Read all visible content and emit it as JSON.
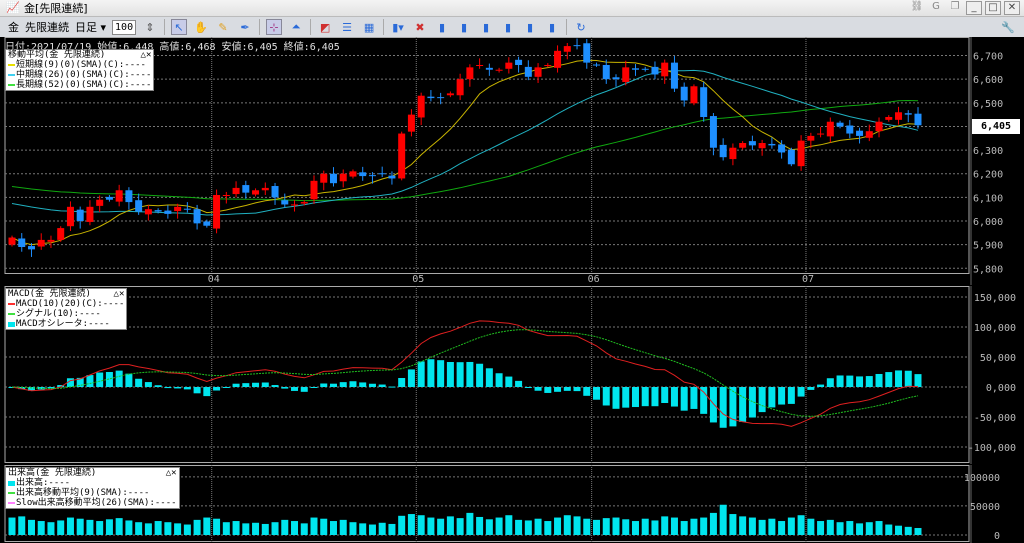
{
  "window": {
    "title": "金[先限連続]"
  },
  "toolbar": {
    "symbol": "金",
    "contract": "先限連続",
    "period": "日足",
    "bars": "100"
  },
  "info": {
    "text": "日付:2021/07/19 始値:6,448 高値:6,468 安値:6,405 終値:6,405"
  },
  "last_price": "6,405",
  "legends": {
    "ma": {
      "title": "移動平均(金 先限連続)",
      "items": [
        {
          "label": "短期線(9)(0)(SMA)(C):----",
          "color": "#e8e000"
        },
        {
          "label": "中期線(26)(0)(SMA)(C):----",
          "color": "#40d0f0"
        },
        {
          "label": "長期線(52)(0)(SMA)(C):----",
          "color": "#40e040"
        }
      ]
    },
    "macd": {
      "title": "MACD(金 先限連続)",
      "items": [
        {
          "label": "MACD(10)(20)(C):----",
          "color": "#ff3030"
        },
        {
          "label": "シグナル(10):----",
          "color": "#40e040"
        },
        {
          "label": "MACDオシレータ:----",
          "color": "#00e5ee"
        }
      ]
    },
    "volume": {
      "title": "出来高(金 先限連続)",
      "items": [
        {
          "label": "出来高:----",
          "color": "#00e5ee"
        },
        {
          "label": "出来高移動平均(9)(SMA):----",
          "color": "#40e040"
        },
        {
          "label": "Slow出来高移動平均(26)(SMA):----",
          "color": "#ff80ff"
        }
      ]
    }
  },
  "colors": {
    "up": "#ff0000",
    "down": "#1e8fff",
    "ma9": "#c8b400",
    "ma26": "#20b0c0",
    "ma52": "#10a810",
    "macd": "#e02020",
    "signal": "#20c020",
    "osc": "#00e5ee"
  },
  "months": [
    {
      "label": "04",
      "index": 20.5
    },
    {
      "label": "05",
      "index": 41.5
    },
    {
      "label": "06",
      "index": 59.5
    },
    {
      "label": "07",
      "index": 81.5
    }
  ],
  "price_axis": {
    "ticks": [
      "6,700",
      "6,600",
      "6,500",
      "6,400",
      "6,300",
      "6,200",
      "6,100",
      "6,000",
      "5,900",
      "5,800"
    ],
    "values": [
      6700,
      6600,
      6500,
      6400,
      6300,
      6200,
      6100,
      6000,
      5900,
      5800
    ]
  },
  "macd_axis": {
    "ticks": [
      "150,000",
      "100,000",
      "50,000",
      "0,000",
      "-50,000",
      "-100,000"
    ],
    "values": [
      150000,
      100000,
      50000,
      0,
      -50000,
      -100000
    ]
  },
  "volume_axis": {
    "ticks": [
      "100000",
      "50000",
      "0"
    ],
    "values": [
      100000,
      50000,
      0
    ]
  },
  "chart_data": {
    "type": "candlestick",
    "closes": [
      5930,
      5890,
      5880,
      5920,
      5920,
      5970,
      6060,
      6000,
      6060,
      6090,
      6090,
      6130,
      6080,
      6040,
      6050,
      6040,
      6030,
      6060,
      6050,
      5990,
      5980,
      6110,
      6110,
      6140,
      6120,
      6130,
      6140,
      6100,
      6070,
      6070,
      6080,
      6170,
      6200,
      6160,
      6200,
      6210,
      6190,
      6190,
      6200,
      6180,
      6370,
      6450,
      6530,
      6520,
      6520,
      6540,
      6600,
      6650,
      6660,
      6640,
      6640,
      6670,
      6660,
      6610,
      6650,
      6660,
      6720,
      6740,
      6740,
      6670,
      6660,
      6600,
      6600,
      6650,
      6640,
      6640,
      6620,
      6670,
      6560,
      6510,
      6570,
      6440,
      6310,
      6270,
      6310,
      6330,
      6320,
      6330,
      6320,
      6290,
      6240,
      6340,
      6360,
      6370,
      6420,
      6400,
      6370,
      6360,
      6380,
      6420,
      6440,
      6460,
      6450,
      6405
    ],
    "volumes": [
      30000,
      32000,
      26000,
      24000,
      22000,
      25000,
      30000,
      28000,
      26000,
      24000,
      27000,
      29000,
      25000,
      22000,
      20000,
      24000,
      22000,
      20000,
      18000,
      26000,
      30000,
      28000,
      22000,
      24000,
      20000,
      21000,
      19000,
      22000,
      26000,
      24000,
      20000,
      30000,
      28000,
      24000,
      26000,
      22000,
      20000,
      18000,
      21000,
      19000,
      33000,
      36000,
      34000,
      30000,
      28000,
      32000,
      29000,
      38000,
      31000,
      27000,
      30000,
      34000,
      26000,
      25000,
      28000,
      24000,
      30000,
      34000,
      32000,
      28000,
      26000,
      29000,
      30000,
      27000,
      24000,
      28000,
      25000,
      32000,
      30000,
      24000,
      28000,
      30000,
      38000,
      52000,
      36000,
      32000,
      30000,
      26000,
      28000,
      24000,
      30000,
      34000,
      28000,
      24000,
      26000,
      22000,
      24000,
      20000,
      22000,
      24000,
      18000,
      16000,
      14000,
      12000
    ],
    "price_ylim": [
      5780,
      6770
    ],
    "macd_ylim": [
      -125000,
      165000
    ],
    "volume_ylim": [
      0,
      110000
    ]
  }
}
